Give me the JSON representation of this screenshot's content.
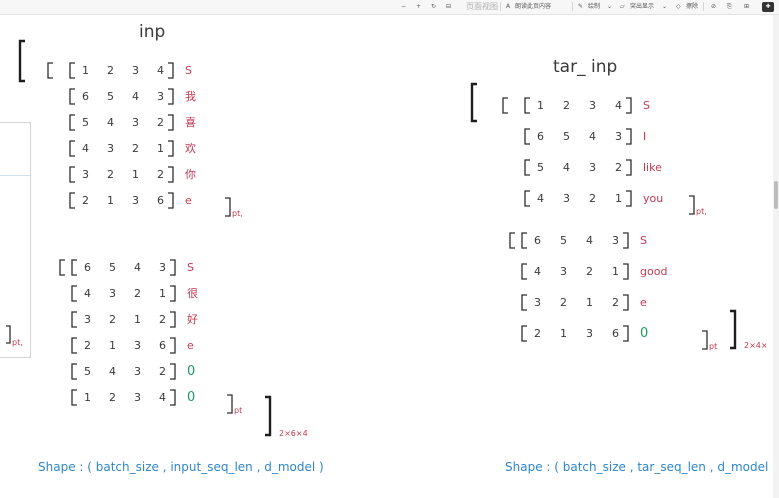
{
  "toolbar": {
    "zoom_out": "−",
    "zoom_in": "+",
    "rotate": "↻",
    "fit": "⊟",
    "page_view": "页面视图",
    "read_aloud": "朗读此页内容",
    "draw": "绘制",
    "highlight": "突出显示",
    "erase": "擦除",
    "icons": [
      "⊘",
      "⎘",
      "⊞",
      "✚"
    ]
  },
  "left": {
    "title": "inp",
    "blocks": [
      {
        "rows": [
          {
            "nums": [
              "1",
              "2",
              "3",
              "4"
            ],
            "token": "S",
            "color": "red"
          },
          {
            "nums": [
              "6",
              "5",
              "4",
              "3"
            ],
            "token": "我",
            "color": "red"
          },
          {
            "nums": [
              "5",
              "4",
              "3",
              "2"
            ],
            "token": "喜",
            "color": "red"
          },
          {
            "nums": [
              "4",
              "3",
              "2",
              "1"
            ],
            "token": "欢",
            "color": "red"
          },
          {
            "nums": [
              "3",
              "2",
              "1",
              "2"
            ],
            "token": "你",
            "color": "red"
          },
          {
            "nums": [
              "2",
              "1",
              "3",
              "6"
            ],
            "token": "e",
            "color": "red"
          }
        ],
        "suffix": "pt,"
      },
      {
        "rows": [
          {
            "nums": [
              "6",
              "5",
              "4",
              "3"
            ],
            "token": "S",
            "color": "red"
          },
          {
            "nums": [
              "4",
              "3",
              "2",
              "1"
            ],
            "token": "很",
            "color": "red"
          },
          {
            "nums": [
              "3",
              "2",
              "1",
              "2"
            ],
            "token": "好",
            "color": "red"
          },
          {
            "nums": [
              "2",
              "1",
              "3",
              "6"
            ],
            "token": "e",
            "color": "red"
          },
          {
            "nums": [
              "5",
              "4",
              "3",
              "2"
            ],
            "token": "0",
            "color": "green"
          },
          {
            "nums": [
              "1",
              "2",
              "3",
              "4"
            ],
            "token": "0",
            "color": "green"
          }
        ],
        "suffix": "pt"
      }
    ],
    "dims": "2×6×4",
    "shape": "Shape : ( batch_size , input_seq_len , d_model )"
  },
  "right": {
    "title": "tar_ inp",
    "blocks": [
      {
        "rows": [
          {
            "nums": [
              "1",
              "2",
              "3",
              "4"
            ],
            "token": "S",
            "color": "red"
          },
          {
            "nums": [
              "6",
              "5",
              "4",
              "3"
            ],
            "token": "I",
            "color": "red"
          },
          {
            "nums": [
              "5",
              "4",
              "3",
              "2"
            ],
            "token": "like",
            "color": "red"
          },
          {
            "nums": [
              "4",
              "3",
              "2",
              "1"
            ],
            "token": "you",
            "color": "red"
          }
        ],
        "suffix": "pt,"
      },
      {
        "rows": [
          {
            "nums": [
              "6",
              "5",
              "4",
              "3"
            ],
            "token": "S",
            "color": "red"
          },
          {
            "nums": [
              "4",
              "3",
              "2",
              "1"
            ],
            "token": "good",
            "color": "red"
          },
          {
            "nums": [
              "3",
              "2",
              "1",
              "2"
            ],
            "token": "e",
            "color": "red"
          },
          {
            "nums": [
              "2",
              "1",
              "3",
              "6"
            ],
            "token": "0",
            "color": "green"
          }
        ],
        "suffix": "pt"
      }
    ],
    "dims": "2×4×",
    "shape": "Shape : ( batch_size , tar_seq_len , d_model )"
  },
  "side_panel_suffix": "pt,"
}
